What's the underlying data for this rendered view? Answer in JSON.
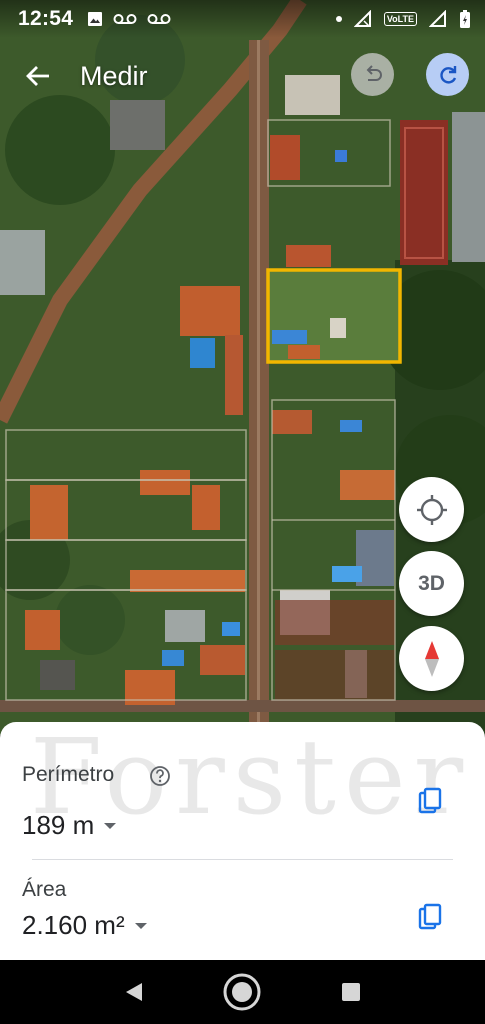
{
  "status_bar": {
    "time": "12:54",
    "left_icons": [
      "image-icon",
      "voicemail-icon",
      "voicemail-icon"
    ],
    "right_icons": [
      "dot-icon",
      "signal-off-icon",
      "volte-icon",
      "signal-icon",
      "battery-charging-icon"
    ],
    "volte_label": "VoLTE"
  },
  "app_bar": {
    "title": "Medir",
    "back_icon": "arrow-left-icon",
    "undo_icon": "undo-icon",
    "redo_icon": "redo-icon"
  },
  "map": {
    "selection_color": "#f2b600",
    "fab_location_icon": "my-location-icon",
    "fab_3d_label": "3D",
    "fab_compass_icon": "compass-icon"
  },
  "sheet": {
    "watermark": "Forster",
    "perimeter_label": "Perímetro",
    "perimeter_value": "189 m",
    "area_label": "Área",
    "area_value": "2.160 m²",
    "help_icon": "help-circle-icon",
    "copy_icon": "copy-icon"
  },
  "nav_bar": {
    "back_icon": "nav-back-icon",
    "home_icon": "nav-home-icon",
    "recents_icon": "nav-recents-icon"
  }
}
